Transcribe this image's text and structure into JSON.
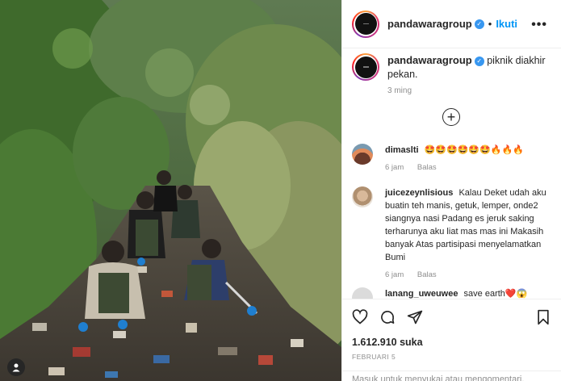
{
  "post": {
    "username": "pandawaragroup",
    "dot": "•",
    "follow_label": "Ikuti",
    "more_label": "•••",
    "caption": "piknik diakhir pekan.",
    "caption_time": "3 ming",
    "likes": "1.612.910 suka",
    "date": "FEBRUARI 5",
    "add_comment_placeholder": "Masuk untuk menyukai atau mengomentari."
  },
  "comments": [
    {
      "user": "dimaslti",
      "text": "🤩🤩🤩🤩🤩🤩🔥🔥🔥",
      "time": "6 jam",
      "reply": "Balas"
    },
    {
      "user": "juicezeynlisious",
      "text": "Kalau Deket udah aku buatin teh manis, getuk, lemper, onde2 siangnya nasi Padang es jeruk saking terharunya aku liat mas mas ini Makasih banyak Atas partisipasi menyelamatkan Bumi",
      "time": "6 jam",
      "reply": "Balas"
    },
    {
      "user": "lanang_uweuwee",
      "text": "save earth❤️😱",
      "time": "",
      "reply": ""
    }
  ],
  "colors": {
    "accent": "#0095f6",
    "verified": "#3897f0",
    "muted": "#8e8e8e"
  },
  "icons": [
    "verified-badge-icon",
    "more-options-icon",
    "load-more-comments-icon",
    "heart-icon",
    "comment-icon",
    "share-icon",
    "bookmark-icon",
    "user-tag-icon"
  ]
}
